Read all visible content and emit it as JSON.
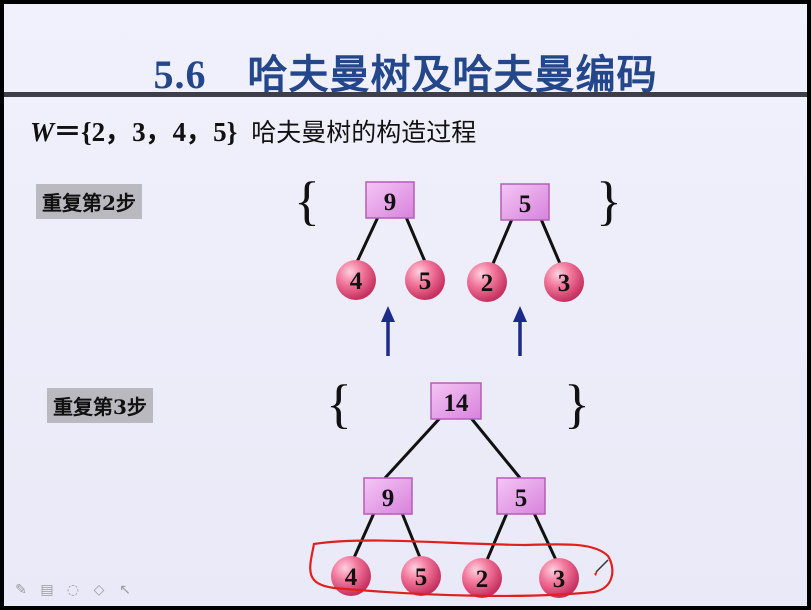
{
  "slide": {
    "title": "5.6　哈夫曼树及哈夫曼编码",
    "subtitle": {
      "w_var": "W",
      "formula": "＝{2，3，4，5}",
      "description": "哈夫曼树的构造过程"
    }
  },
  "steps": [
    {
      "label": "重复第2步"
    },
    {
      "label": "重复第3步"
    }
  ],
  "step2": {
    "brace_open": "{",
    "brace_close": "}",
    "trees": [
      {
        "root": "9",
        "left": "4",
        "right": "5"
      },
      {
        "root": "5",
        "left": "2",
        "right": "3"
      }
    ]
  },
  "step3": {
    "brace_open": "{",
    "brace_close": "}",
    "root": "14",
    "children": [
      {
        "root": "9",
        "left": "4",
        "right": "5"
      },
      {
        "root": "5",
        "left": "2",
        "right": "3"
      }
    ]
  },
  "colors": {
    "title": "#24468a",
    "square_node": "#e49be8",
    "circle_node": "#ee6f93",
    "arrow": "#1c2a8a",
    "annotation": "#e0201d"
  },
  "toolbar": {
    "icons": [
      "pen-icon",
      "slide-list-icon",
      "eraser-icon",
      "highlighter-icon",
      "pointer-icon"
    ]
  }
}
